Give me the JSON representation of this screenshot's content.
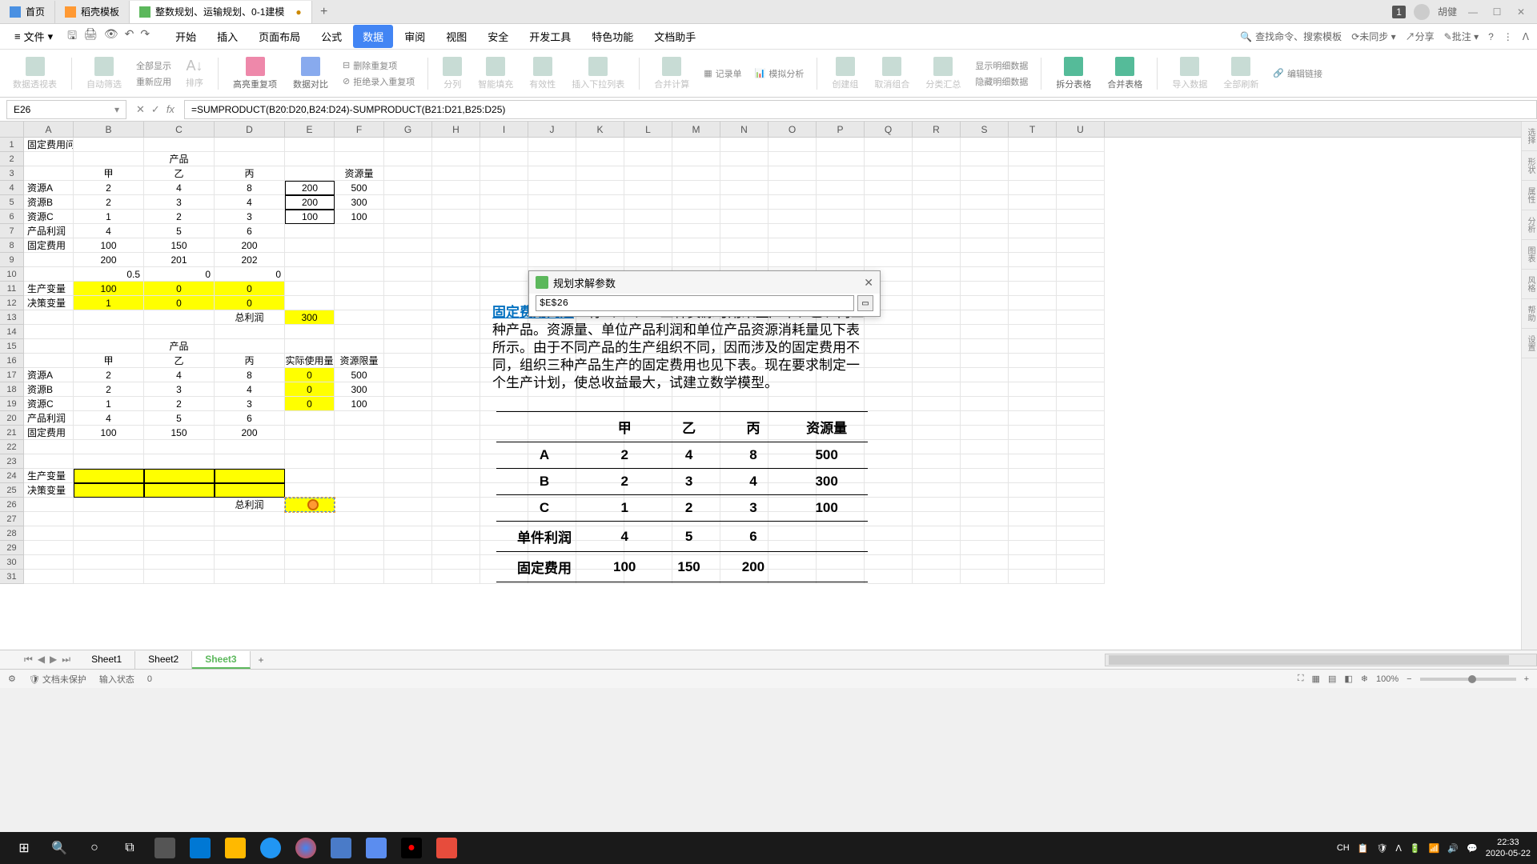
{
  "tabs": {
    "home": "首页",
    "template": "稻壳模板",
    "doc": "整数规划、运输规划、0-1建模"
  },
  "user": {
    "badge": "1",
    "name": "胡健"
  },
  "file_menu": "文件",
  "menus": [
    "开始",
    "插入",
    "页面布局",
    "公式",
    "数据",
    "审阅",
    "视图",
    "安全",
    "开发工具",
    "特色功能",
    "文档助手"
  ],
  "active_menu": "数据",
  "search_placeholder": "查找命令、搜索模板",
  "menu_right": {
    "unsync": "未同步",
    "share": "分享",
    "approve": "批注"
  },
  "ribbon": {
    "pivot": "数据透视表",
    "autofilter": "自动筛选",
    "showall": "全部显示",
    "reapply": "重新应用",
    "sort": "排序",
    "highlight": "高亮重复项",
    "compare": "数据对比",
    "deldup": "删除重复项",
    "reject": "拒绝录入重复项",
    "split": "分列",
    "smartfill": "智能填充",
    "validity": "有效性",
    "dropdown": "插入下拉列表",
    "consolidate": "合并计算",
    "recordform": "记录单",
    "sim": "模拟分析",
    "group": "创建组",
    "ungroup": "取消组合",
    "subtotal": "分类汇总",
    "showdetail": "显示明细数据",
    "hidedetail": "隐藏明细数据",
    "splittable": "拆分表格",
    "mergetable": "合并表格",
    "import": "导入数据",
    "refreshall": "全部刷新",
    "edit": "编辑链接"
  },
  "name_box": "E26",
  "formula": "=SUMPRODUCT(B20:D20,B24:D24)-SUMPRODUCT(B21:D21,B25:D25)",
  "columns": [
    "A",
    "B",
    "C",
    "D",
    "E",
    "F",
    "G",
    "H",
    "I",
    "J",
    "K",
    "L",
    "M",
    "N",
    "O",
    "P",
    "Q",
    "R",
    "S",
    "T",
    "U"
  ],
  "row_count": 31,
  "cells": {
    "A1": "固定费用问题",
    "C2": "产品",
    "B3": "甲",
    "C3": "乙",
    "D3": "丙",
    "F3": "资源量",
    "A4": "资源A",
    "B4": "2",
    "C4": "4",
    "D4": "8",
    "E4": "200",
    "F4": "500",
    "A5": "资源B",
    "B5": "2",
    "C5": "3",
    "D5": "4",
    "E5": "200",
    "F5": "300",
    "A6": "资源C",
    "B6": "1",
    "C6": "2",
    "D6": "3",
    "E6": "100",
    "F6": "100",
    "A7": "产品利润",
    "B7": "4",
    "C7": "5",
    "D7": "6",
    "A8": "固定费用",
    "B8": "100",
    "C8": "150",
    "D8": "200",
    "B9": "200",
    "C9": "201",
    "D9": "202",
    "B10": "0.5",
    "C10": "0",
    "D10": "0",
    "A11": "生产变量",
    "B11": "100",
    "C11": "0",
    "D11": "0",
    "A12": "决策变量",
    "B12": "1",
    "C12": "0",
    "D12": "0",
    "D13": "总利润",
    "E13": "300",
    "C15": "产品",
    "B16": "甲",
    "C16": "乙",
    "D16": "丙",
    "E16": "实际使用量",
    "F16": "资源限量",
    "A17": "资源A",
    "B17": "2",
    "C17": "4",
    "D17": "8",
    "E17": "0",
    "F17": "500",
    "A18": "资源B",
    "B18": "2",
    "C18": "3",
    "D18": "4",
    "E18": "0",
    "F18": "300",
    "A19": "资源C",
    "B19": "1",
    "C19": "2",
    "D19": "3",
    "E19": "0",
    "F19": "100",
    "A20": "产品利润",
    "B20": "4",
    "C20": "5",
    "D20": "6",
    "A21": "固定费用",
    "B21": "100",
    "C21": "150",
    "D21": "200",
    "A24": "生产变量",
    "A25": "决策变量",
    "D26": "总利润"
  },
  "dialog": {
    "title": "规划求解参数",
    "input": "$E$26"
  },
  "problem": {
    "title": "固定费用问题",
    "body": "　有A、B、C 三种资源可用来生产甲、乙、丙三种产品。资源量、单位产品利润和单位产品资源消耗量见下表所示。由于不同产品的生产组织不同，因而涉及的固定费用不同，组织三种产品生产的固定费用也见下表。现在要求制定一个生产计划，使总收益最大，试建立数学模型。",
    "headers": [
      "",
      "甲",
      "乙",
      "丙",
      "资源量"
    ],
    "rows": [
      [
        "A",
        "2",
        "4",
        "8",
        "500"
      ],
      [
        "B",
        "2",
        "3",
        "4",
        "300"
      ],
      [
        "C",
        "1",
        "2",
        "3",
        "100"
      ],
      [
        "单件利润",
        "4",
        "5",
        "6",
        ""
      ],
      [
        "固定费用",
        "100",
        "150",
        "200",
        ""
      ]
    ]
  },
  "sheets": [
    "Sheet1",
    "Sheet2",
    "Sheet3"
  ],
  "active_sheet": "Sheet3",
  "status": {
    "protect": "文档未保护",
    "mode": "输入状态",
    "count": "0",
    "zoom": "100%"
  },
  "side": [
    "选择",
    "形状",
    "属性",
    "分析",
    "图表",
    "风格",
    "帮助",
    "设置"
  ],
  "taskbar": {
    "ime": "CH",
    "time": "22:33",
    "date": "2020-05-22"
  },
  "col_widths": {
    "A": 62,
    "B": 88,
    "C": 88,
    "D": 88,
    "E": 62,
    "F": 62,
    "default": 60
  }
}
